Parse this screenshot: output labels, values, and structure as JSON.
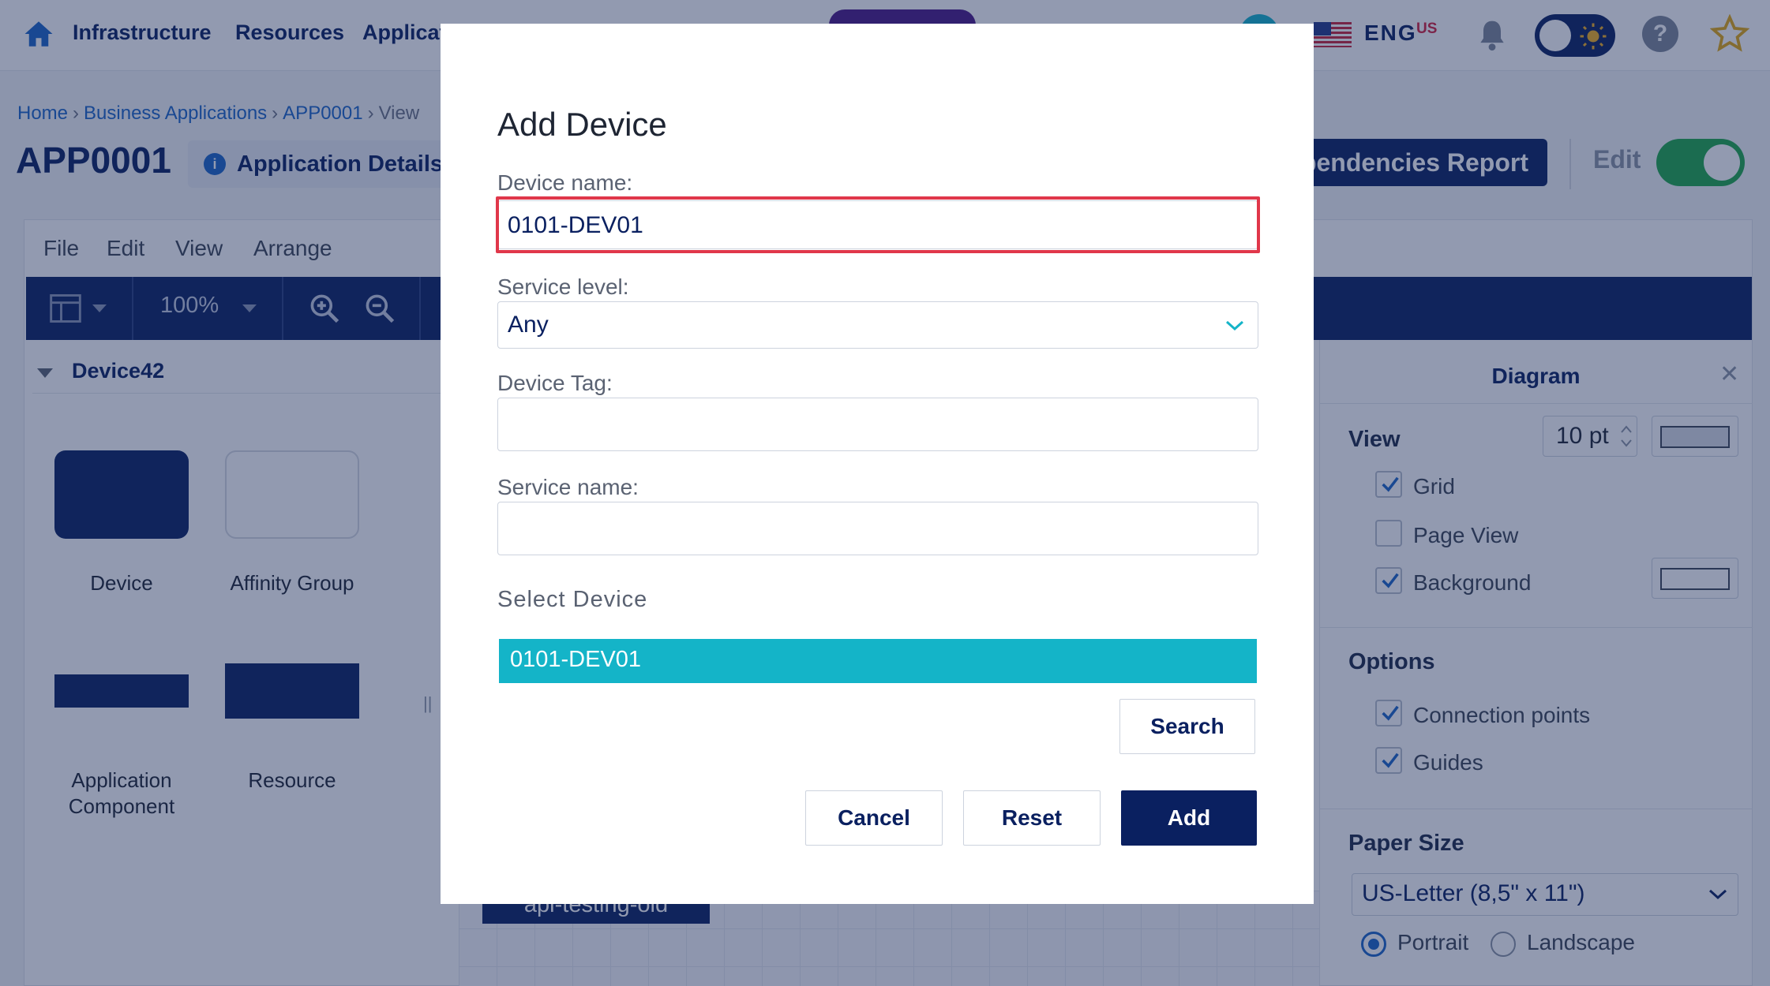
{
  "nav": {
    "links": [
      "Infrastructure",
      "Resources",
      "Applicat"
    ],
    "lang": "ENG",
    "lang_region": "US",
    "help": "?"
  },
  "breadcrumb": [
    "Home",
    "Business Applications",
    "APP0001",
    "View"
  ],
  "header": {
    "title": "APP0001",
    "details_label": "Application Details",
    "report_label": "Dependencies Report",
    "edit_label": "Edit"
  },
  "editor": {
    "menu": [
      "File",
      "Edit",
      "View",
      "Arrange"
    ],
    "zoom": "100%",
    "library_title": "Device42",
    "shapes": [
      "Device",
      "Affinity Group",
      "Application Component",
      "Resource"
    ],
    "splitter": "||",
    "canvas_node": "api-testing-old"
  },
  "right_panel": {
    "title": "Diagram",
    "close": "✕",
    "view_section": "View",
    "grid": "Grid",
    "grid_size": "10 pt",
    "page_view": "Page View",
    "background": "Background",
    "options_section": "Options",
    "connection_points": "Connection points",
    "guides": "Guides",
    "paper_section": "Paper Size",
    "paper_value": "US-Letter (8,5\" x 11\")",
    "portrait": "Portrait",
    "landscape": "Landscape"
  },
  "modal": {
    "title": "Add Device",
    "device_name_label": "Device name:",
    "device_name_value": "0101-DEV01",
    "service_level_label": "Service level:",
    "service_level_value": "Any",
    "device_tag_label": "Device Tag:",
    "service_name_label": "Service name:",
    "select_device_label": "Select Device",
    "result": "0101-DEV01",
    "search": "Search",
    "cancel": "Cancel",
    "reset": "Reset",
    "add": "Add"
  },
  "colors": {
    "primary": "#0a2060",
    "accent": "#14b4c8",
    "highlight": "#e0374a",
    "toggle_on": "#1fa84a",
    "link": "#1b64c6"
  }
}
